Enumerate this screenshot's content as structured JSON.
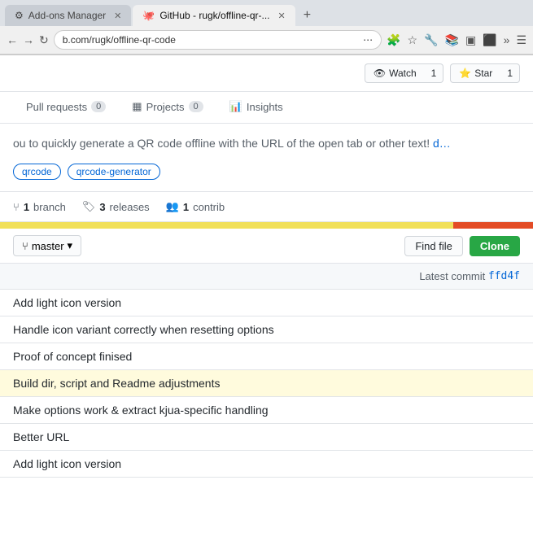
{
  "browser": {
    "tabs": [
      {
        "id": "tab-addons",
        "label": "Add-ons Manager",
        "favicon": "⚙",
        "active": false
      },
      {
        "id": "tab-github",
        "label": "GitHub - rugk/offline-qr-...",
        "favicon": "🐙",
        "active": true
      }
    ],
    "url": "b.com/rugk/offline-qr-code",
    "new_tab_label": "+"
  },
  "repo": {
    "watch_label": "Watch",
    "watch_count": "1",
    "star_label": "Star",
    "star_count": "1",
    "nav_items": [
      {
        "id": "pull-requests",
        "label": "Pull requests",
        "badge": "0",
        "active": false
      },
      {
        "id": "projects",
        "label": "Projects",
        "badge": "0",
        "active": false
      },
      {
        "id": "insights",
        "label": "Insights",
        "badge": "",
        "active": false
      }
    ],
    "description": "ou to quickly generate a QR code offline with the URL of the open tab or other text!",
    "read_more": "d…",
    "tags": [
      "qrcode",
      "qrcode-generator"
    ],
    "stats": {
      "branch_count": "1",
      "branch_label": "branch",
      "releases_count": "3",
      "releases_label": "releases",
      "contributors_count": "1",
      "contributors_label": "contrib"
    },
    "code_toolbar": {
      "branch_label": "master",
      "find_file_label": "Find file",
      "clone_label": "Clone"
    },
    "commit_info": {
      "label": "Latest commit",
      "hash": "ffd4f"
    },
    "files": [
      {
        "name": "Add light icon version",
        "commit": "",
        "highlighted": false
      },
      {
        "name": "Handle icon variant correctly when resetting options",
        "commit": "",
        "highlighted": false
      },
      {
        "name": "Proof of concept finised",
        "commit": "",
        "highlighted": false
      },
      {
        "name": "Build dir, script and Readme adjustments",
        "commit": "",
        "highlighted": true
      },
      {
        "name": "Make options work & extract kjua-specific handling",
        "commit": "",
        "highlighted": false
      },
      {
        "name": "Better URL",
        "commit": "",
        "highlighted": false
      },
      {
        "name": "Add light icon version",
        "commit": "",
        "highlighted": false
      }
    ]
  }
}
